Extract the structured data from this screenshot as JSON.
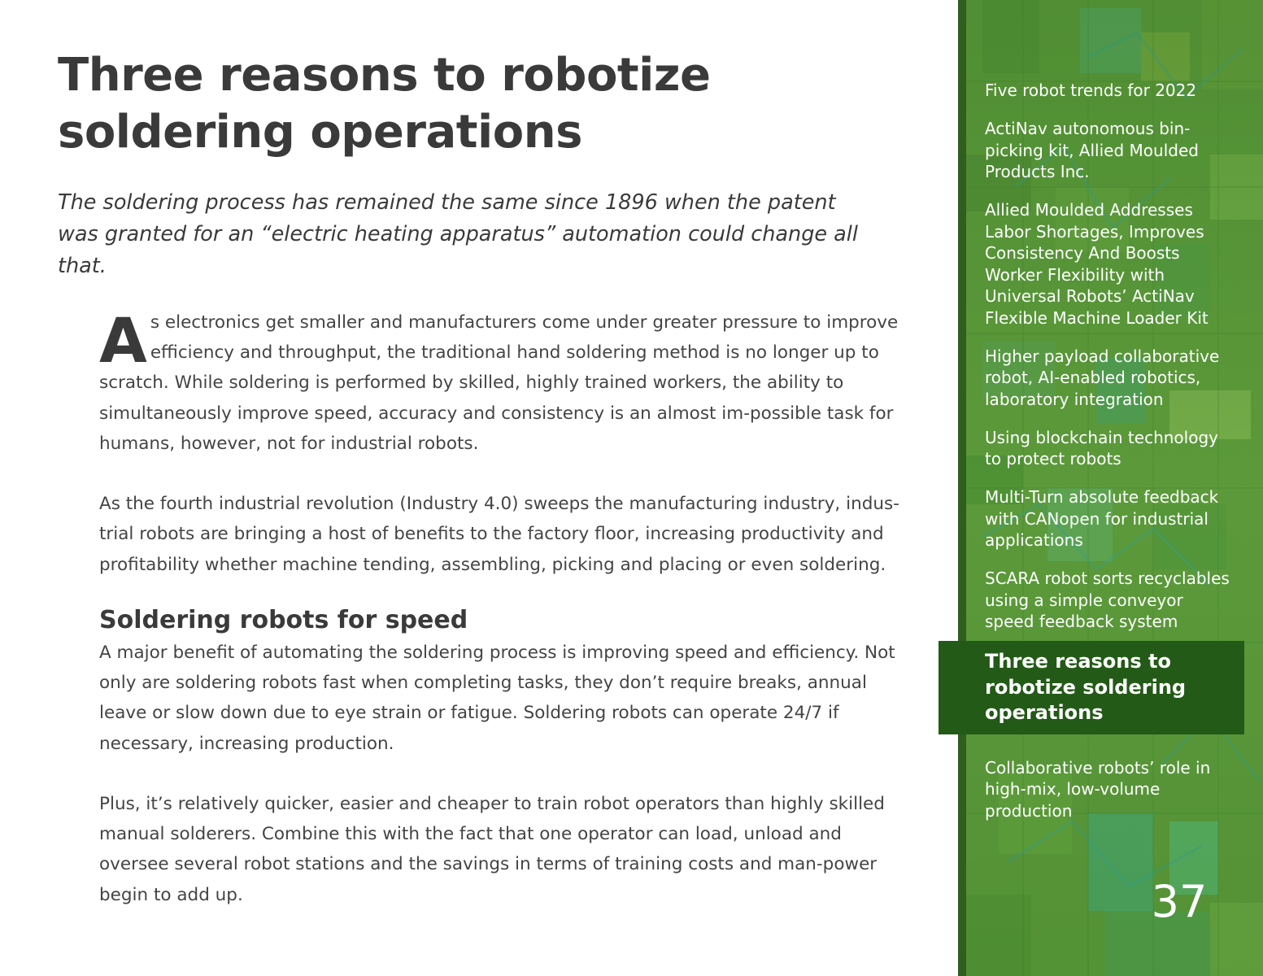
{
  "article": {
    "title_line1": "Three reasons to robotize",
    "title_line2": "soldering operations",
    "deck": "The soldering process has remained the same since 1896 when the patent was granted for an “electric heating apparatus” automation could change all that.",
    "dropcap": "A",
    "para1": "s electronics get smaller and manufacturers come under greater pressure to improve efficiency and throughput, the traditional hand soldering method is no longer up to scratch. While soldering is performed by skilled, highly trained workers, the ability to simultaneously improve speed, accuracy and consistency is an almost im-possible task for humans, however, not for industrial robots.",
    "para2": "As the fourth industrial revolution (Industry 4.0) sweeps the manufacturing industry, indus-trial robots are bringing a host of benefits to the factory floor, increasing productivity and profitability whether machine tending, assembling, picking and placing or even soldering.",
    "subhead": "Soldering robots for speed",
    "para3": "A major benefit of automating the soldering process is improving speed and efficiency. Not only are soldering robots fast when completing tasks, they don’t require breaks, annual leave or slow down due to eye strain or fatigue. Soldering robots can operate 24/7 if necessary, increasing production.",
    "para4": "Plus, it’s relatively quicker, easier and cheaper to train robot operators than highly skilled manual solderers. Combine this with the fact that one operator can load, unload and oversee several robot stations and the savings in terms of training costs and man-power begin to add up."
  },
  "sidebar": {
    "items": [
      {
        "label": "Five robot trends for 2022"
      },
      {
        "label": "ActiNav autonomous bin-picking kit, Allied Moulded Products Inc."
      },
      {
        "label": "Allied Moulded Addresses Labor Shortages, Improves Consistency And Boosts Worker Flexibility with Universal Robots’ ActiNav Flexible Machine Loader Kit"
      },
      {
        "label": "Higher payload collaborative robot, AI-enabled robotics, laboratory integration"
      },
      {
        "label": "Using blockchain technology to protect robots"
      },
      {
        "label": "Multi-Turn absolute feedback with CANopen for industrial applications"
      },
      {
        "label": "SCARA robot sorts recyclables using a simple conveyor speed feedback system"
      },
      {
        "label": "Three reasons to robotize soldering operations",
        "active": true
      },
      {
        "label": "Collaborative robots’ role in high-mix, low-volume production"
      }
    ],
    "page_number": "37",
    "colors": {
      "background": "#5c9a3a",
      "active": "#235a17",
      "edge": "#2f5e1f"
    }
  }
}
